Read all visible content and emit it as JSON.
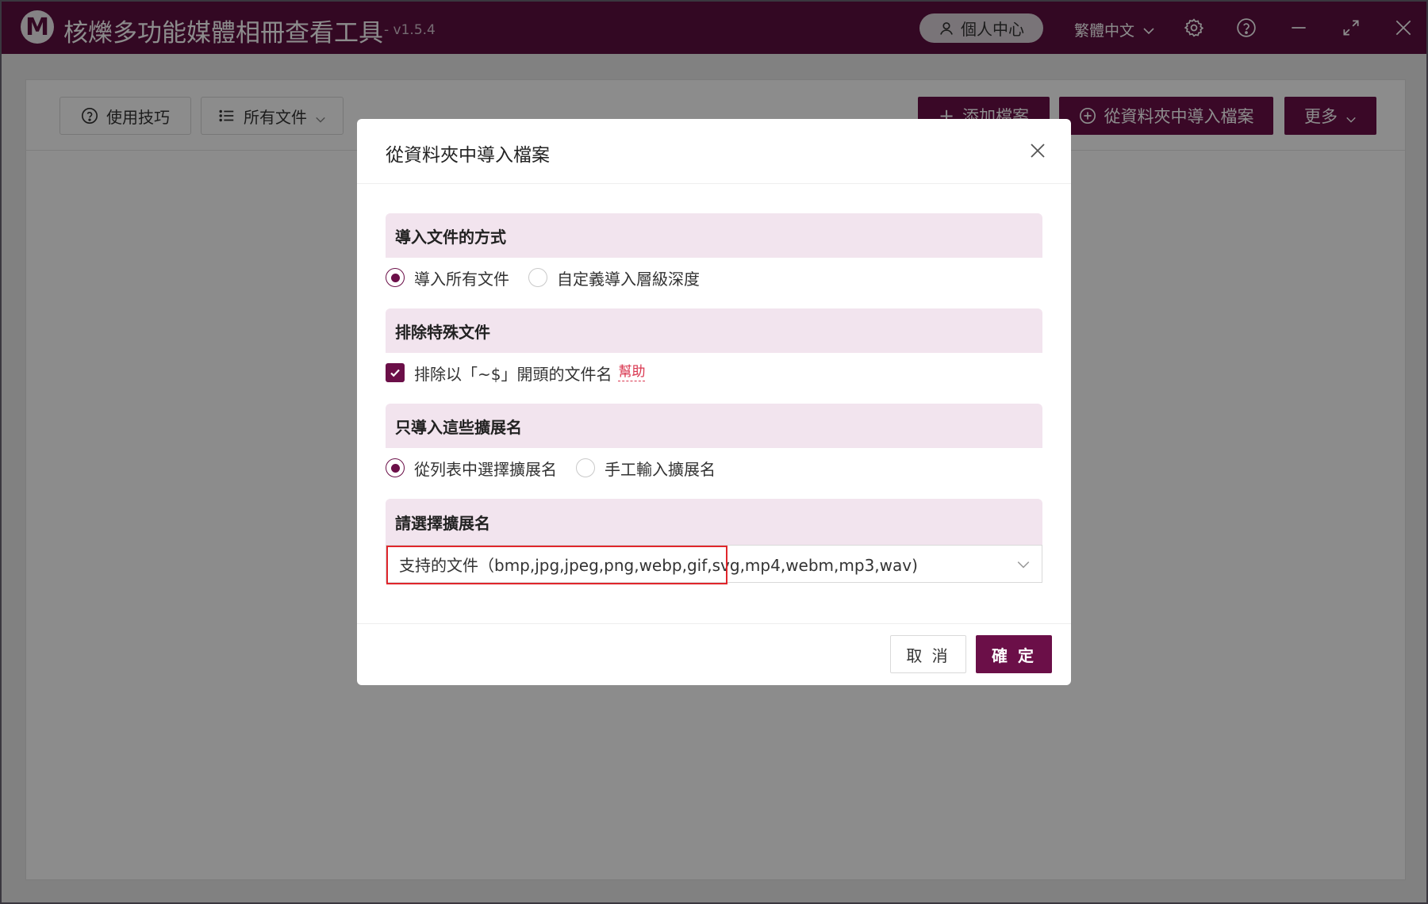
{
  "app": {
    "logo_letter": "M",
    "title": "核爍多功能媒體相冊查看工具",
    "version": "- v1.5.4",
    "user_center": "個人中心",
    "language": "繁體中文"
  },
  "toolbar": {
    "tips": "使用技巧",
    "all_files": "所有文件",
    "add_file": "添加檔案",
    "import_folder": "從資料夾中導入檔案",
    "more": "更多"
  },
  "dialog": {
    "title": "從資料夾中導入檔案",
    "sections": {
      "import_mode": {
        "heading": "導入文件的方式",
        "options": [
          "導入所有文件",
          "自定義導入層級深度"
        ],
        "selected": "導入所有文件"
      },
      "exclude": {
        "heading": "排除特殊文件",
        "checkbox_label": "排除以「~$」開頭的文件名",
        "checked": true,
        "help": "幫助"
      },
      "extensions": {
        "heading": "只導入這些擴展名",
        "options": [
          "從列表中選擇擴展名",
          "手工輸入擴展名"
        ],
        "selected": "從列表中選擇擴展名"
      },
      "choose_ext": {
        "heading": "請選擇擴展名",
        "value": "支持的文件（bmp,jpg,jpeg,png,webp,gif,svg,mp4,webm,mp3,wav)"
      }
    },
    "cancel": "取 消",
    "confirm": "確 定"
  },
  "colors": {
    "brand": "#6b0f48",
    "titlebar": "#5e0f40",
    "section_bg": "#f2e4ee",
    "highlight": "#e0262c",
    "help_link": "#d9364f"
  }
}
